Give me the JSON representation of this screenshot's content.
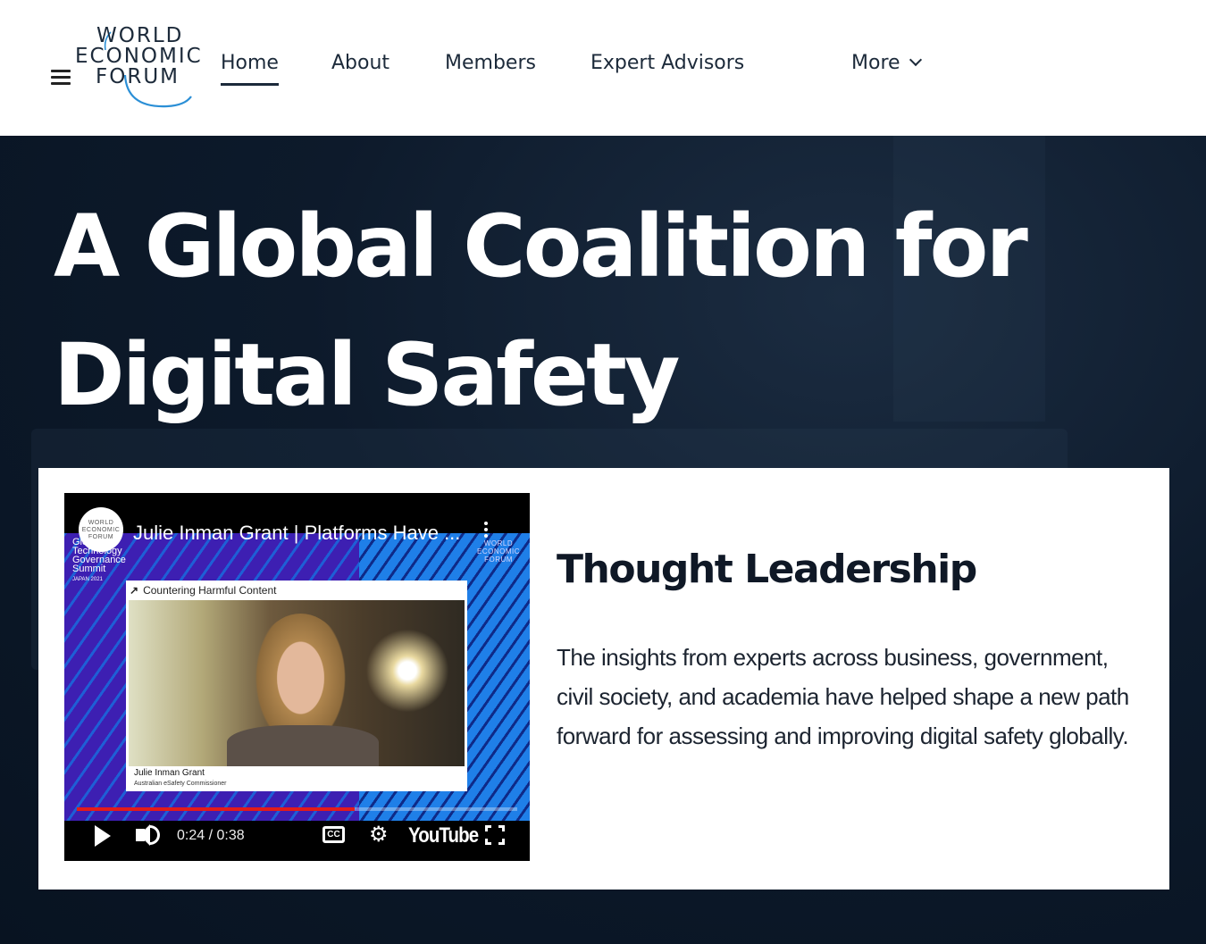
{
  "logo": {
    "line1": "WORLD",
    "line2": "ECONOMIC",
    "line3": "FORUM"
  },
  "nav": {
    "home": "Home",
    "about": "About",
    "members": "Members",
    "expert_advisors": "Expert Advisors",
    "more": "More"
  },
  "hero": {
    "title": "A Global Coalition for Digital Safety"
  },
  "video": {
    "channel_logo": {
      "line1": "WORLD",
      "line2": "ECONOMIC",
      "line3": "FORUM"
    },
    "title": "Julie Inman Grant | Platforms Have ...",
    "summit": "Global Technology Governance Summit",
    "summit_sub": "JAPAN 2021",
    "watermark": "WORLD ECONOMIC FORUM",
    "segment_label": "Countering Harmful Content",
    "speaker_name": "Julie Inman Grant",
    "speaker_role": "Australian eSafety Commissioner",
    "time": "0:24 / 0:38",
    "progress": 0.63,
    "platform": "YouTube"
  },
  "section": {
    "title": "Thought Leadership",
    "body": "The insights from experts across business, government, civil society, and academia have helped shape a new path forward for assessing and improving digital safety globally."
  }
}
